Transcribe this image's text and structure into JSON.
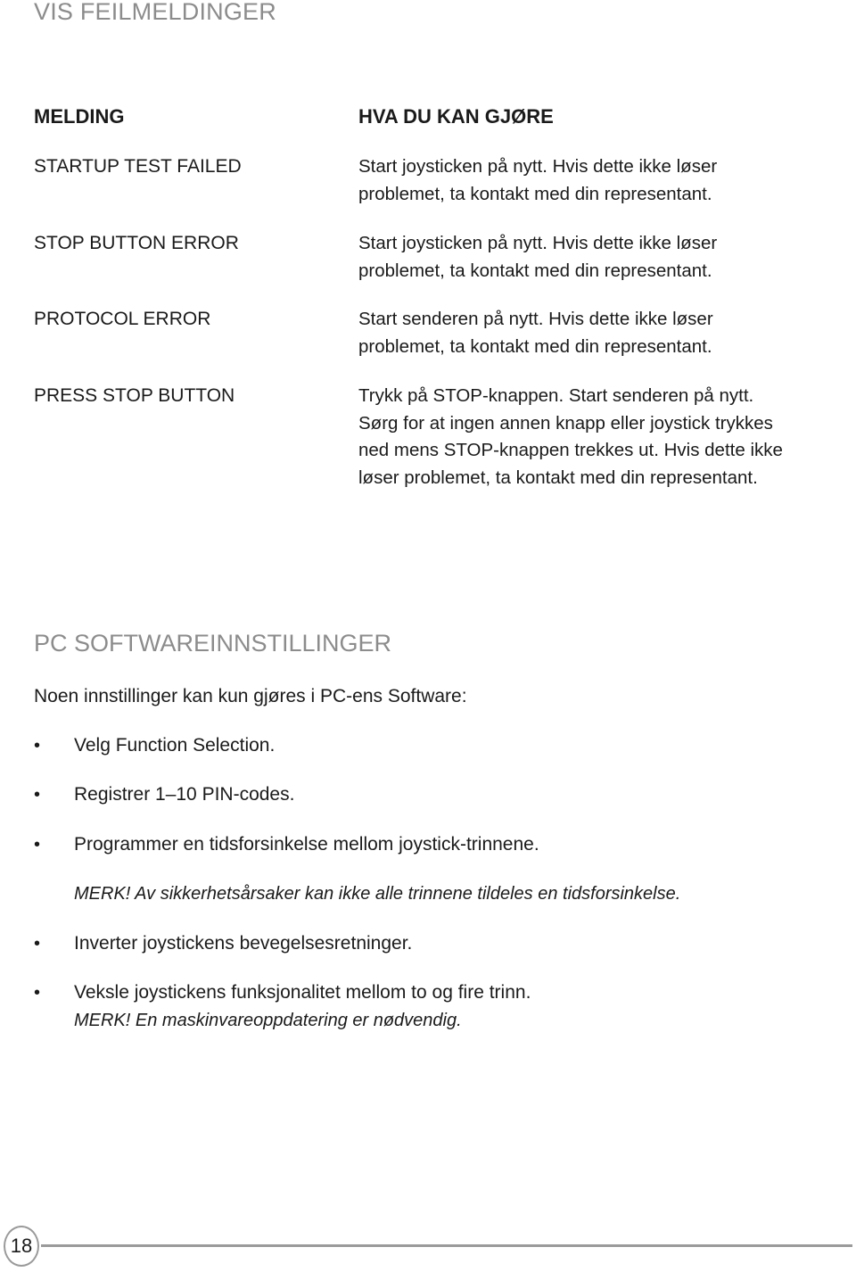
{
  "page": {
    "title": "VIS FEILMELDINGER",
    "number": "18"
  },
  "errors_table": {
    "header_message": "MELDING",
    "header_action": "HVA DU KAN GJØRE",
    "rows": [
      {
        "message": "STARTUP TEST FAILED",
        "action_lines": [
          "Start joysticken på nytt. Hvis dette ikke løser",
          "problemet, ta kontakt med din representant."
        ]
      },
      {
        "message": "STOP BUTTON ERROR",
        "action_lines": [
          "Start joysticken på nytt. Hvis dette ikke løser",
          "problemet, ta kontakt med din representant."
        ]
      },
      {
        "message": "PROTOCOL ERROR",
        "action_lines": [
          "Start senderen på nytt. Hvis dette ikke løser",
          "problemet, ta kontakt med din representant."
        ]
      },
      {
        "message": "PRESS STOP BUTTON",
        "action_lines": [
          "Trykk på STOP-knappen. Start senderen på nytt.",
          "Sørg for at ingen annen knapp eller joystick trykkes",
          "ned mens STOP-knappen trekkes ut. Hvis dette ikke",
          "løser problemet, ta kontakt med din representant."
        ]
      }
    ]
  },
  "pc_software": {
    "title": "PC SOFTWAREINNSTILLINGER",
    "intro": "Noen innstillinger kan kun gjøres i PC-ens Software:",
    "bullet_symbol": "•",
    "items": [
      {
        "text": "Velg Function Selection."
      },
      {
        "text": "Registrer 1–10 PIN-codes."
      },
      {
        "text": "Programmer en tidsforsinkelse mellom joystick-trinnene."
      },
      {
        "text": "Inverter joystickens bevegelsesretninger."
      },
      {
        "text": "Veksle joystickens funksjonalitet mellom to og fire trinn."
      }
    ],
    "notes": [
      "MERK! Av sikkerhetsårsaker kan ikke alle trinnene tildeles en tidsforsinkelse.",
      "MERK!  En maskinvareoppdatering er nødvendig."
    ]
  }
}
